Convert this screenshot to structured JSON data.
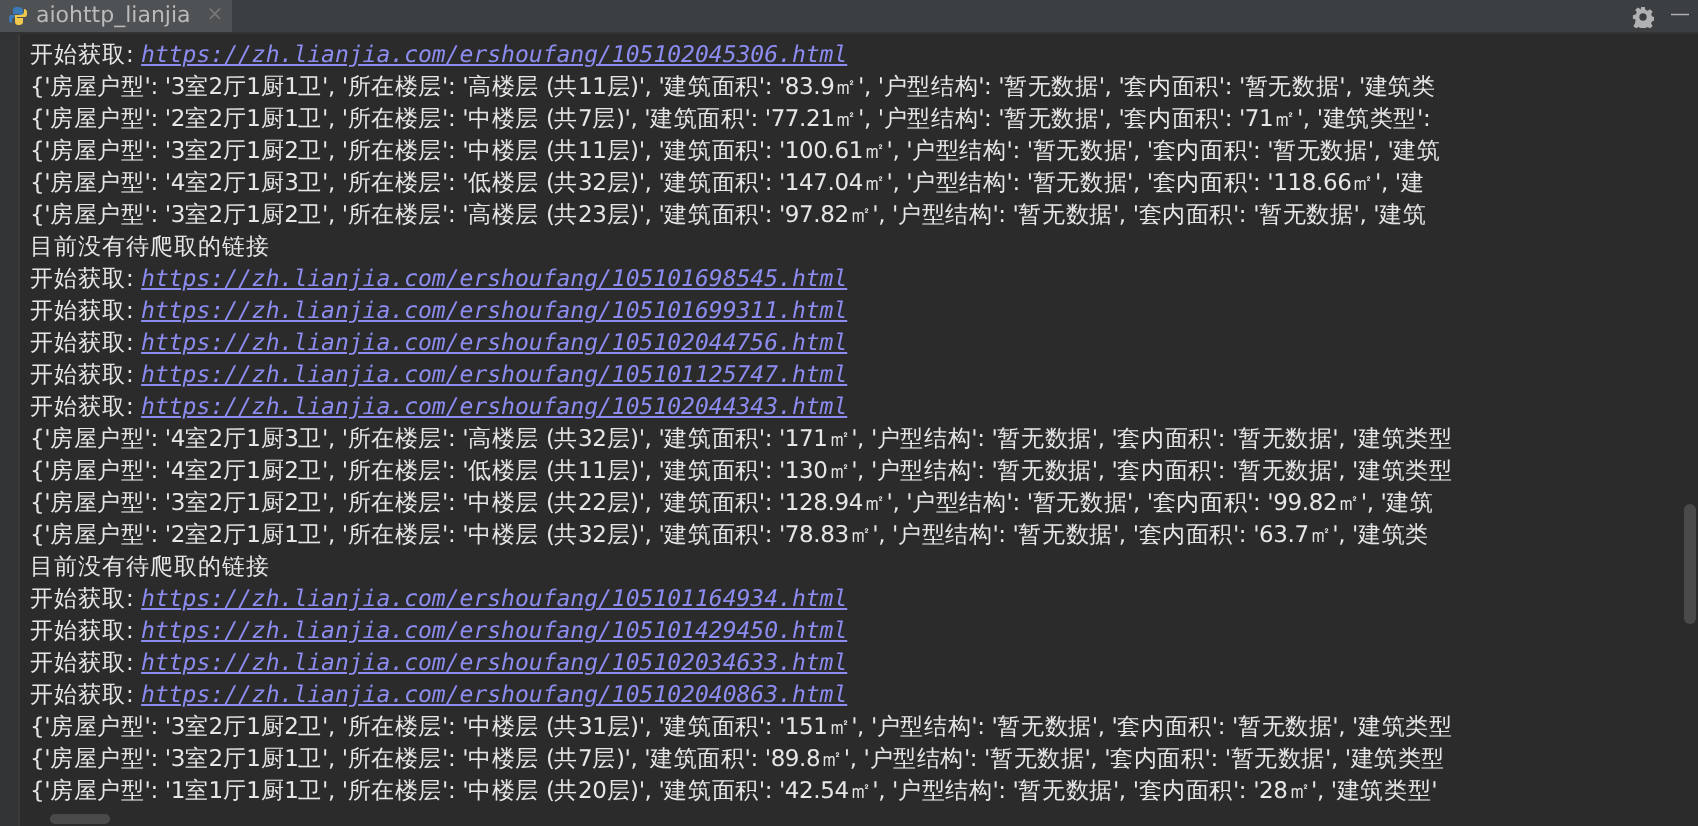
{
  "tab": {
    "title": "aiohttp_lianjia",
    "close": "×",
    "selected": true
  },
  "window_controls": {
    "minimize": "—"
  },
  "console_lines": [
    {
      "kind": "link",
      "label": "开始获取: ",
      "url": "https://zh.lianjia.com/ershoufang/105102045306.html"
    },
    {
      "kind": "dict",
      "text": "{'房屋户型': '3室2厅1厨1卫', '所在楼层': '高楼层 (共11层)', '建筑面积': '83.9㎡', '户型结构': '暂无数据', '套内面积': '暂无数据', '建筑类"
    },
    {
      "kind": "dict",
      "text": "{'房屋户型': '2室2厅1厨1卫', '所在楼层': '中楼层 (共7层)', '建筑面积': '77.21㎡', '户型结构': '暂无数据', '套内面积': '71㎡', '建筑类型':"
    },
    {
      "kind": "dict",
      "text": "{'房屋户型': '3室2厅1厨2卫', '所在楼层': '中楼层 (共11层)', '建筑面积': '100.61㎡', '户型结构': '暂无数据', '套内面积': '暂无数据', '建筑"
    },
    {
      "kind": "dict",
      "text": "{'房屋户型': '4室2厅1厨3卫', '所在楼层': '低楼层 (共32层)', '建筑面积': '147.04㎡', '户型结构': '暂无数据', '套内面积': '118.66㎡', '建"
    },
    {
      "kind": "dict",
      "text": "{'房屋户型': '3室2厅1厨2卫', '所在楼层': '高楼层 (共23层)', '建筑面积': '97.82㎡', '户型结构': '暂无数据', '套内面积': '暂无数据', '建筑"
    },
    {
      "kind": "status",
      "text": "目前没有待爬取的链接"
    },
    {
      "kind": "link",
      "label": "开始获取: ",
      "url": "https://zh.lianjia.com/ershoufang/105101698545.html"
    },
    {
      "kind": "link",
      "label": "开始获取: ",
      "url": "https://zh.lianjia.com/ershoufang/105101699311.html"
    },
    {
      "kind": "link",
      "label": "开始获取: ",
      "url": "https://zh.lianjia.com/ershoufang/105102044756.html"
    },
    {
      "kind": "link",
      "label": "开始获取: ",
      "url": "https://zh.lianjia.com/ershoufang/105101125747.html"
    },
    {
      "kind": "link",
      "label": "开始获取: ",
      "url": "https://zh.lianjia.com/ershoufang/105102044343.html"
    },
    {
      "kind": "dict",
      "text": "{'房屋户型': '4室2厅1厨3卫', '所在楼层': '高楼层 (共32层)', '建筑面积': '171㎡', '户型结构': '暂无数据', '套内面积': '暂无数据', '建筑类型"
    },
    {
      "kind": "dict",
      "text": "{'房屋户型': '4室2厅1厨2卫', '所在楼层': '低楼层 (共11层)', '建筑面积': '130㎡', '户型结构': '暂无数据', '套内面积': '暂无数据', '建筑类型"
    },
    {
      "kind": "dict",
      "text": "{'房屋户型': '3室2厅1厨2卫', '所在楼层': '中楼层 (共22层)', '建筑面积': '128.94㎡', '户型结构': '暂无数据', '套内面积': '99.82㎡', '建筑"
    },
    {
      "kind": "dict",
      "text": "{'房屋户型': '2室2厅1厨1卫', '所在楼层': '中楼层 (共32层)', '建筑面积': '78.83㎡', '户型结构': '暂无数据', '套内面积': '63.7㎡', '建筑类"
    },
    {
      "kind": "status",
      "text": "目前没有待爬取的链接"
    },
    {
      "kind": "link",
      "label": "开始获取: ",
      "url": "https://zh.lianjia.com/ershoufang/105101164934.html"
    },
    {
      "kind": "link",
      "label": "开始获取: ",
      "url": "https://zh.lianjia.com/ershoufang/105101429450.html"
    },
    {
      "kind": "link",
      "label": "开始获取: ",
      "url": "https://zh.lianjia.com/ershoufang/105102034633.html"
    },
    {
      "kind": "link",
      "label": "开始获取: ",
      "url": "https://zh.lianjia.com/ershoufang/105102040863.html"
    },
    {
      "kind": "dict",
      "text": "{'房屋户型': '3室2厅1厨2卫', '所在楼层': '中楼层 (共31层)', '建筑面积': '151㎡', '户型结构': '暂无数据', '套内面积': '暂无数据', '建筑类型"
    },
    {
      "kind": "dict",
      "text": "{'房屋户型': '3室2厅1厨1卫', '所在楼层': '中楼层 (共7层)', '建筑面积': '89.8㎡', '户型结构': '暂无数据', '套内面积': '暂无数据', '建筑类型"
    },
    {
      "kind": "dict",
      "text": "{'房屋户型': '1室1厅1厨1卫', '所在楼层': '中楼层 (共20层)', '建筑面积': '42.54㎡', '户型结构': '暂无数据', '套内面积': '28㎡', '建筑类型'"
    }
  ]
}
